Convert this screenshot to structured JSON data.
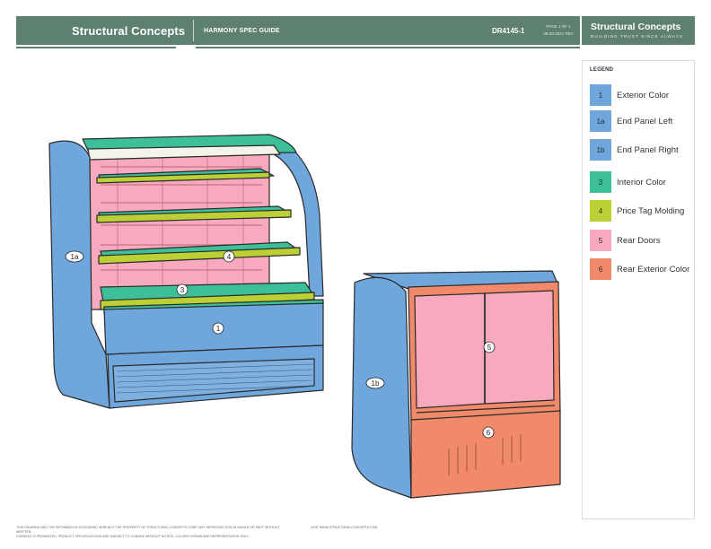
{
  "header": {
    "brand": "Structural Concepts",
    "guide_title": "HARMONY SPEC GUIDE",
    "model": "DR4145-1",
    "meta_line_1": "PAGE 1 OF 1",
    "meta_line_2": "08-20-2021 REV",
    "right_brand": "Structural Concepts",
    "right_tagline": "BUILDING TRUST SINCE ALWAYS"
  },
  "legend": {
    "title": "LEGEND",
    "items": [
      {
        "code": "1",
        "label": "Exterior Color",
        "color": "#6fa6dc"
      },
      {
        "code": "1a",
        "label": "End Panel Left",
        "color": "#6fa6dc"
      },
      {
        "code": "1b",
        "label": "End Panel Right",
        "color": "#6fa6dc"
      },
      {
        "code": "3",
        "label": "Interior Color",
        "color": "#3dbf9a"
      },
      {
        "code": "4",
        "label": "Price Tag Molding",
        "color": "#bcd035"
      },
      {
        "code": "5",
        "label": "Rear Doors",
        "color": "#f7a9bd"
      },
      {
        "code": "6",
        "label": "Rear Exterior Color",
        "color": "#f08a6a"
      }
    ]
  },
  "callouts": {
    "c1": "1",
    "c1a": "1a",
    "c1b": "1b",
    "c3": "3",
    "c4": "4",
    "c5": "5",
    "c6": "6"
  },
  "footer": {
    "note_left_1": "THIS DRAWING AND THE INFORMATION CONTAINED HEREIN IS THE PROPERTY OF STRUCTURAL CONCEPTS CORP. ANY REPRODUCTION IN WHOLE OR PART WITHOUT WRITTEN",
    "note_left_2": "CONSENT IS PROHIBITED. PRODUCT SPECIFICATIONS ARE SUBJECT TO CHANGE WITHOUT NOTICE. COLORS SHOWN ARE REPRESENTATIVE ONLY.",
    "note_right": "VISIT WWW.STRUCTURALCONCEPTS.COM"
  }
}
